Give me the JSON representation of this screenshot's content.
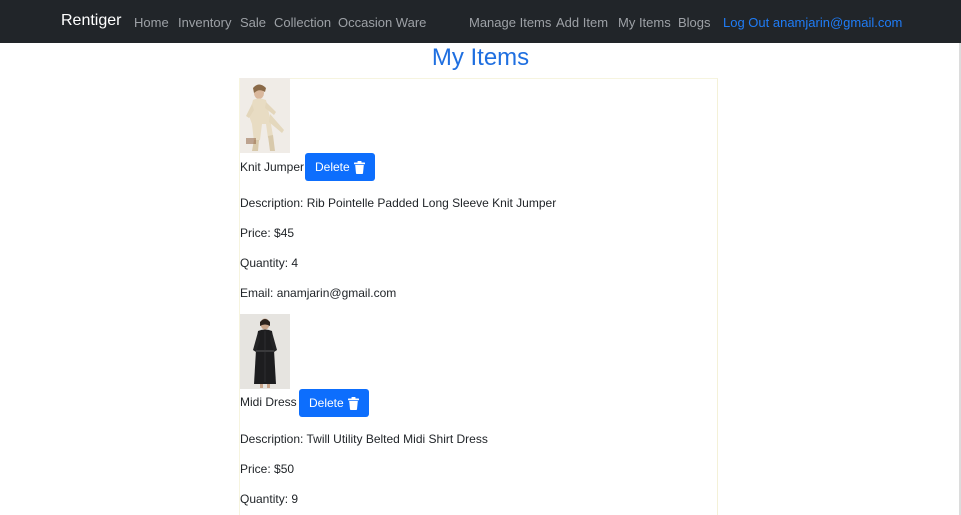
{
  "navbar": {
    "brand": "Rentiger",
    "links": [
      "Home",
      "Inventory",
      "Sale",
      "Collection",
      "Occasion Ware"
    ],
    "right_links": [
      "Manage Items",
      "Add Item",
      "My Items",
      "Blogs"
    ],
    "account_link": "Log Out anamjarin@gmail.com"
  },
  "page": {
    "title": "My Items"
  },
  "labels": {
    "description_prefix": "Description: ",
    "price_prefix": "Price: ",
    "quantity_prefix": "Quantity: ",
    "email_prefix": "Email: ",
    "delete_button": "Delete"
  },
  "items": [
    {
      "name": "Knit Jumper",
      "description": "Rib Pointelle Padded Long Sleeve Knit Jumper",
      "price": "$45",
      "quantity": "4",
      "email": "anamjarin@gmail.com",
      "photo_icon": "knit-jumper-photo"
    },
    {
      "name": "Midi Dress",
      "description": "Twill Utility Belted Midi Shirt Dress",
      "price": "$50",
      "quantity": "9",
      "email": "",
      "photo_icon": "midi-dress-photo"
    }
  ],
  "colors": {
    "navbar_bg": "#212529",
    "accent": "#0d6efd",
    "title": "#1f6fe0",
    "account_link": "#1f7cf6"
  }
}
